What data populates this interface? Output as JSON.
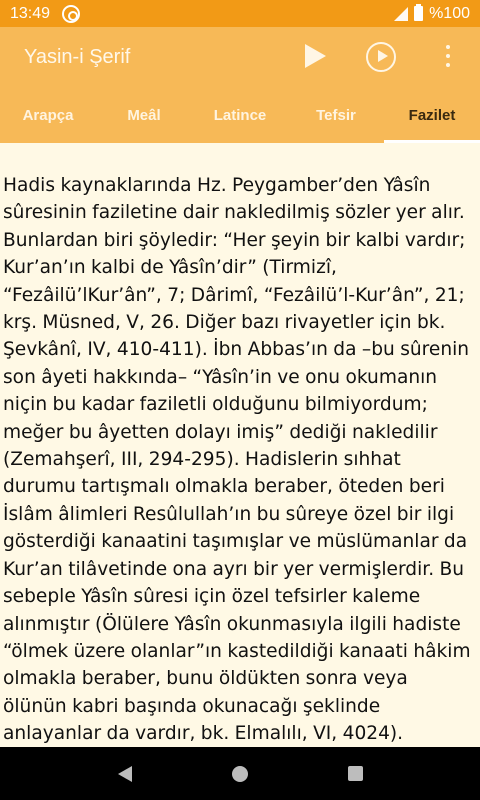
{
  "status_bar": {
    "time": "13:49",
    "battery": "%100",
    "icons": [
      "at-icon",
      "signal-icon",
      "battery-icon"
    ]
  },
  "app_bar": {
    "title": "Yasin-i Şerif",
    "actions": [
      "play-icon",
      "play-circle-icon",
      "more-icon"
    ]
  },
  "tabs": [
    {
      "label": "Arapça",
      "active": false
    },
    {
      "label": "Meâl",
      "active": false
    },
    {
      "label": "Latince",
      "active": false
    },
    {
      "label": "Tefsir",
      "active": false
    },
    {
      "label": "Fazilet",
      "active": true
    }
  ],
  "content": {
    "text": "Hadis kaynaklarında Hz. Peygamber’den Yâsîn sûresinin faziletine dair nakledilmiş sözler yer alır. Bunlardan biri şöyledir: “Her şeyin bir kalbi vardır; Kur’an’ın kalbi de Yâsîn’dir” (Tirmizî, “Fezâilü’lKur’ân”, 7; Dârimî,  “Fezâilü’l-Kur’ân”, 21; krş. Müsned, V, 26. Diğer bazı rivayetler için bk. Şevkânî, IV, 410-411). İbn Abbas’ın da –bu sûrenin son âyeti  hakkında– “Yâsîn’in ve onu okumanın niçin bu kadar faziletli olduğunu bilmiyordum; meğer bu âyetten dolayı imiş” dediği nakledilir (Zemahşerî, III, 294-295). Hadislerin sıhhat durumu tartışmalı olmakla beraber, öteden beri İslâm âlimleri Resûlullah’ın bu sûreye özel bir ilgi gösterdiği kanaatini taşımışlar ve müslümanlar da Kur’an tilâvetinde ona ayrı bir yer vermişlerdir. Bu sebeple Yâsîn sûresi için özel tefsirler kaleme alınmıştır (Ölülere Yâsîn okunmasıyla ilgili hadiste “ölmek üzere olanlar”ın kastedildiği kanaati hâkim olmakla beraber, bunu öldükten sonra veya ölünün kabri başında okunacağı şeklinde anlayanlar da vardır, bk. Elmalılı, VI, 4024)."
  },
  "nav_bar": {
    "icons": [
      "back-icon",
      "home-icon",
      "recent-apps-icon"
    ]
  }
}
